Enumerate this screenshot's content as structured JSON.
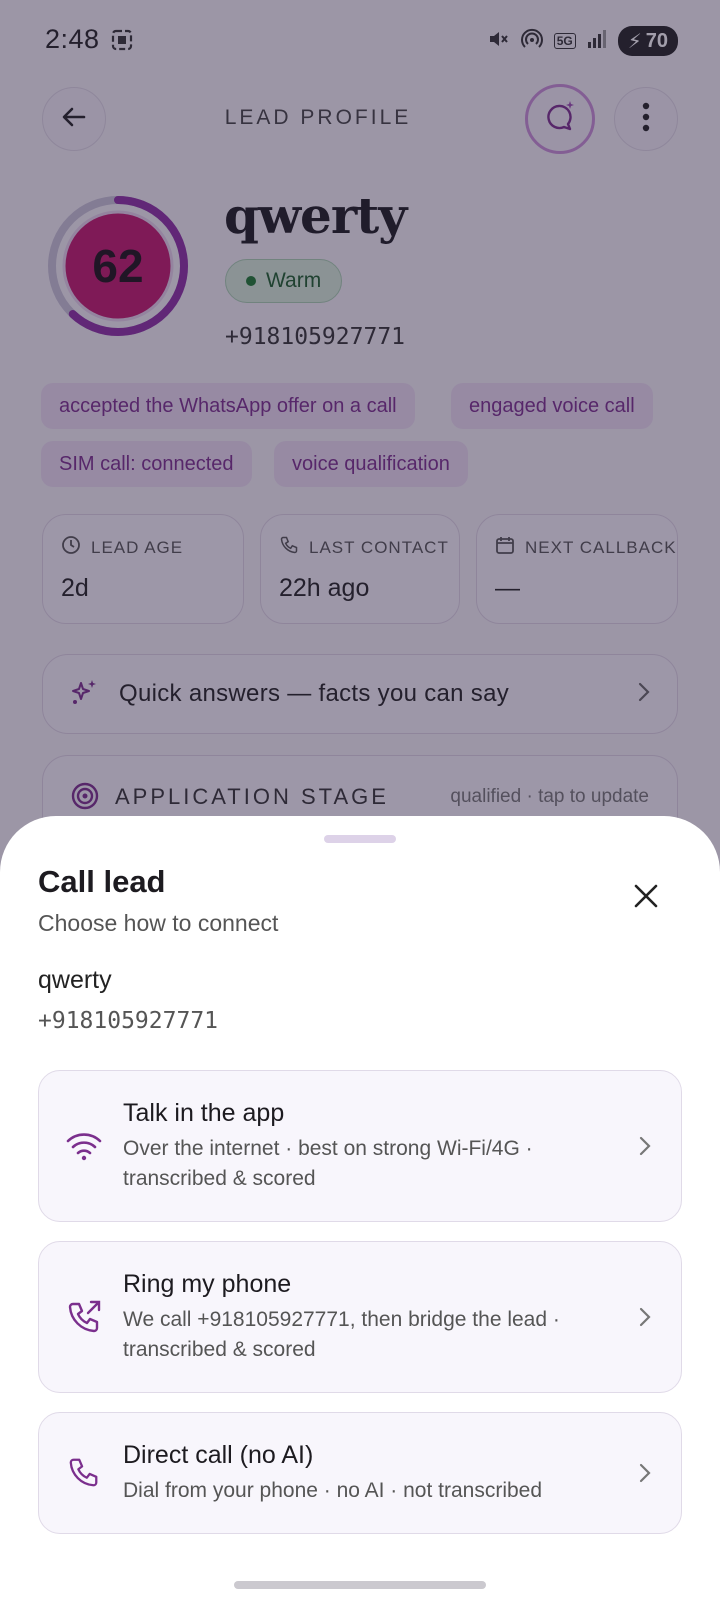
{
  "status_bar": {
    "time": "2:48",
    "network": "5G",
    "battery": "70"
  },
  "header": {
    "title": "LEAD PROFILE",
    "icons": [
      "back-arrow-icon",
      "chat-sparkle-icon",
      "more-vert-icon"
    ]
  },
  "lead": {
    "score": "62",
    "score_fraction": 0.62,
    "name": "qwerty",
    "temperature": "Warm",
    "phone": "+918105927771",
    "tags": [
      "accepted the WhatsApp offer on a call",
      "engaged voice call",
      "SIM call: connected",
      "voice qualification"
    ]
  },
  "stats": [
    {
      "label": "LEAD AGE",
      "value": "2d",
      "icon": "clock-icon"
    },
    {
      "label": "LAST CONTACT",
      "value": "22h ago",
      "icon": "phone-icon"
    },
    {
      "label": "NEXT CALLBACK",
      "value": "—",
      "icon": "calendar-icon"
    }
  ],
  "quick_answers": {
    "label": "Quick answers — facts you can say"
  },
  "application_stage": {
    "label": "APPLICATION STAGE",
    "meta": "qualified · tap to update"
  },
  "sheet": {
    "title": "Call lead",
    "subtitle": "Choose how to connect",
    "lead_name": "qwerty",
    "lead_phone": "+918105927771",
    "options": [
      {
        "title": "Talk in the app",
        "description": "Over the internet · best on strong Wi-Fi/4G · transcribed & scored",
        "icon": "wifi-icon"
      },
      {
        "title": "Ring my phone",
        "description": "We call +918105927771, then bridge the lead · transcribed & scored",
        "icon": "phone-forward-icon"
      },
      {
        "title": "Direct call (no AI)",
        "description": "Dial from your phone · no AI · not transcribed",
        "icon": "phone-icon"
      }
    ]
  },
  "colors": {
    "accent": "#7b2f8d",
    "score_fill": "#c2186b",
    "warm_badge": "#d6ecd9",
    "scrim": "#281e3c"
  }
}
